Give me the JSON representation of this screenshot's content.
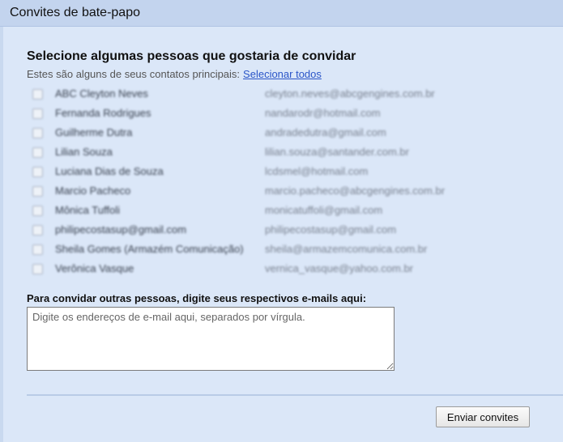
{
  "window": {
    "title": "Convites de bate-papo"
  },
  "main": {
    "heading": "Selecione algumas pessoas que gostaria de convidar",
    "subtitle": "Estes são alguns de seus contatos principais:",
    "select_all_label": "Selecionar todos",
    "contacts": [
      {
        "name": "ABC Cleyton Neves",
        "email": "cleyton.neves@abcgengines.com.br"
      },
      {
        "name": "Fernanda Rodrigues",
        "email": "nandarodr@hotmail.com"
      },
      {
        "name": "Guilherme Dutra",
        "email": "andradedutra@gmail.com"
      },
      {
        "name": "Lilian Souza",
        "email": "lilian.souza@santander.com.br"
      },
      {
        "name": "Luciana Dias de Souza",
        "email": "lcdsmel@hotmail.com"
      },
      {
        "name": "Marcio Pacheco",
        "email": "marcio.pacheco@abcgengines.com.br"
      },
      {
        "name": "Mônica Tuffoli",
        "email": "monicatuffoli@gmail.com"
      },
      {
        "name": "philipecostasup@gmail.com",
        "email": "philipecostasup@gmail.com"
      },
      {
        "name": "Sheila Gomes (Armazém Comunicação)",
        "email": "sheila@armazemcomunica.com.br"
      },
      {
        "name": "Verônica Vasque",
        "email": "vernica_vasque@yahoo.com.br"
      }
    ],
    "invite_prompt": "Para convidar outras pessoas, digite seus respectivos e-mails aqui:",
    "invite_input": {
      "value": "",
      "placeholder": "Digite os endereços de e-mail aqui, separados por vírgula."
    },
    "send_button_label": "Enviar convites"
  }
}
